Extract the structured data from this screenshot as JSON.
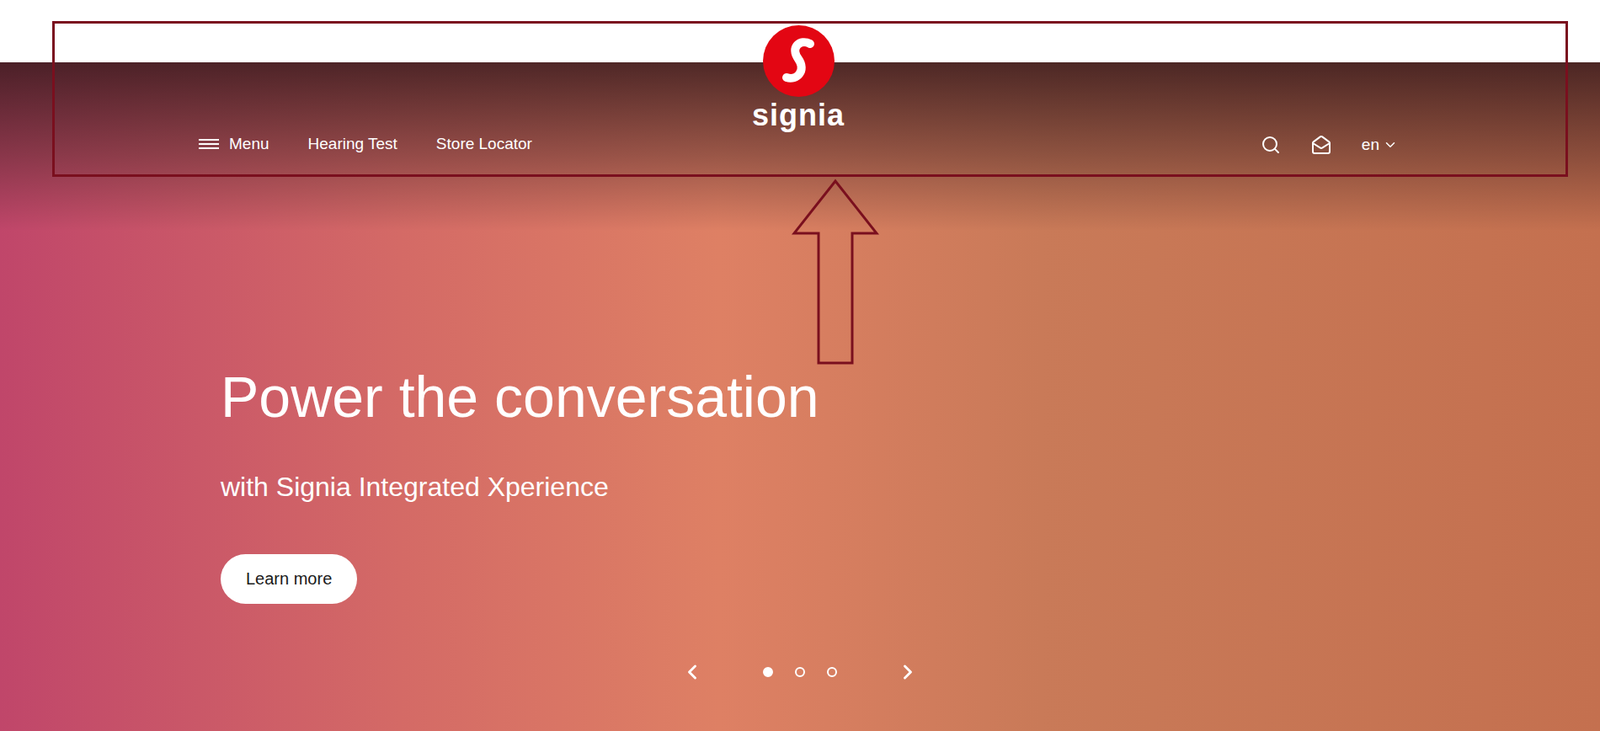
{
  "header": {
    "nav": [
      {
        "label": "Menu",
        "kind": "menu"
      },
      {
        "label": "Hearing Test",
        "kind": "link"
      },
      {
        "label": "Store Locator",
        "kind": "link"
      }
    ],
    "logo": {
      "wordmark": "signia"
    },
    "language": {
      "label": "en",
      "expanded": false
    }
  },
  "hero": {
    "title": "Power the conversation",
    "subtitle": "with Signia Integrated Xperience",
    "button": "Learn more",
    "slides": [
      {
        "selected": true
      },
      {
        "selected": false
      },
      {
        "selected": false
      }
    ]
  }
}
